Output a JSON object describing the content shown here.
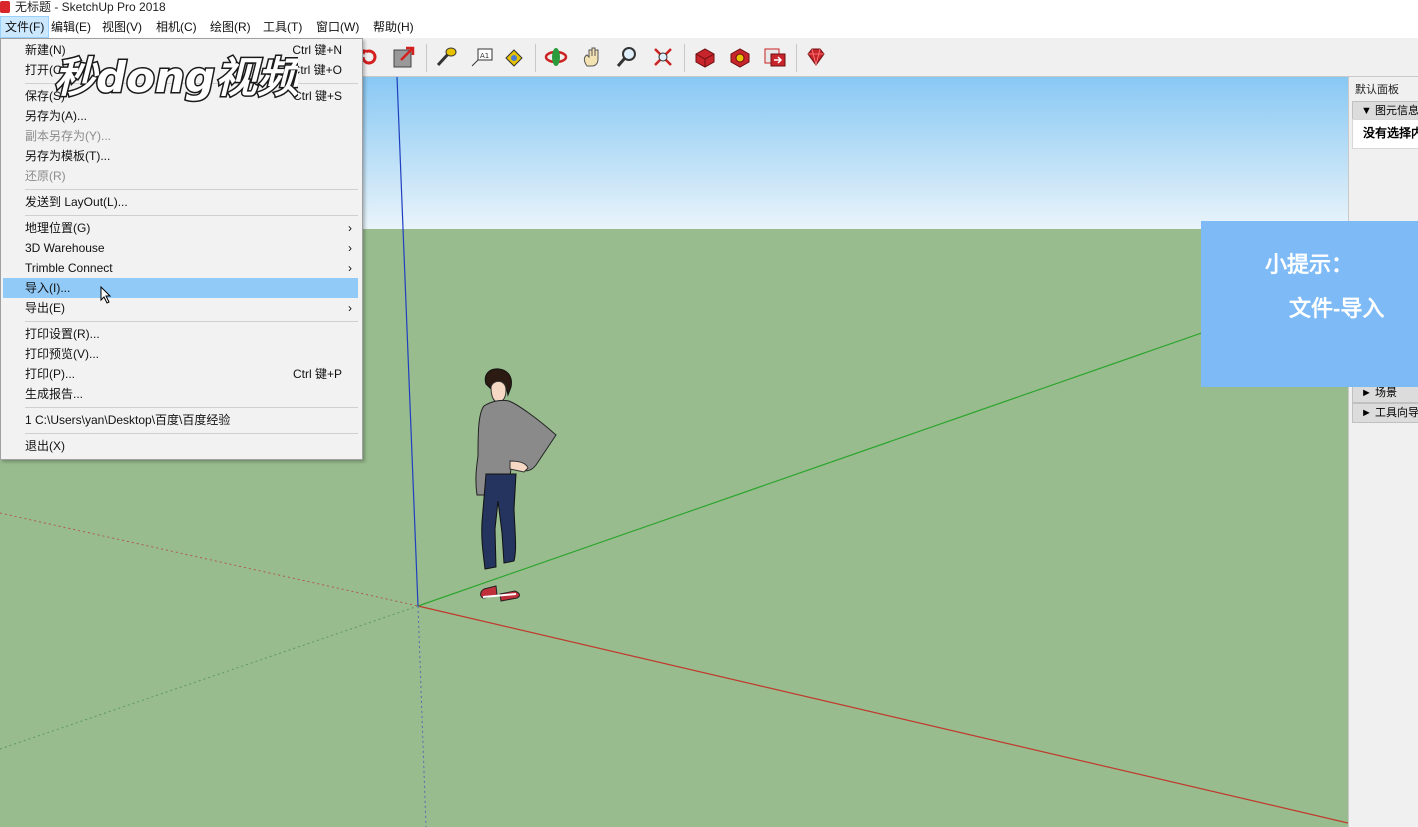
{
  "window": {
    "title": "无标题 - SketchUp Pro 2018"
  },
  "menubar": [
    {
      "label": "文件(F)",
      "active": true
    },
    {
      "label": "编辑(E)"
    },
    {
      "label": "视图(V)"
    },
    {
      "label": "相机(C)"
    },
    {
      "label": "绘图(R)"
    },
    {
      "label": "工具(T)"
    },
    {
      "label": "窗口(W)"
    },
    {
      "label": "帮助(H)"
    }
  ],
  "toolbar": {
    "icons": [
      "rotate-icon",
      "export-icon",
      "tape-measure-icon",
      "text-tool-icon",
      "paint-bucket-icon",
      "orbit-icon",
      "pan-icon",
      "zoom-icon",
      "zoom-extents-icon",
      "3d-warehouse-icon",
      "extension-warehouse-icon",
      "layout-icon",
      "ruby-icon"
    ]
  },
  "file_menu": {
    "items": [
      {
        "label": "新建(N)",
        "shortcut": "Ctrl 键+N"
      },
      {
        "label": "打开(O)...",
        "shortcut": "Ctrl 键+O"
      },
      {
        "label": "保存(S)",
        "shortcut": "Ctrl 键+S"
      },
      {
        "label": "另存为(A)..."
      },
      {
        "label": "副本另存为(Y)...",
        "disabled": true
      },
      {
        "label": "另存为模板(T)..."
      },
      {
        "label": "还原(R)",
        "disabled": true
      },
      {
        "label": "发送到 LayOut(L)..."
      },
      {
        "label": "地理位置(G)",
        "submenu": true
      },
      {
        "label": "3D Warehouse",
        "submenu": true
      },
      {
        "label": "Trimble Connect",
        "submenu": true
      },
      {
        "label": "导入(I)...",
        "highlighted": true
      },
      {
        "label": "导出(E)",
        "submenu": true
      },
      {
        "label": "打印设置(R)..."
      },
      {
        "label": "打印预览(V)..."
      },
      {
        "label": "打印(P)...",
        "shortcut": "Ctrl 键+P"
      },
      {
        "label": "生成报告..."
      },
      {
        "label": "1 C:\\Users\\yan\\Desktop\\百度\\百度经验"
      },
      {
        "label": "退出(X)"
      }
    ],
    "submenu_glyph": "›"
  },
  "watermark": {
    "text": "秒dong视频"
  },
  "tip": {
    "line1": "小提示：",
    "line2": "文件-导入"
  },
  "tray": {
    "title": "默认面板",
    "entity_info": "▼ 图元信息",
    "no_selection": "没有选择内容",
    "scenes": "► 场景",
    "instructor": "► 工具向导"
  },
  "colors": {
    "sky_top": "#88c8f4",
    "ground": "#98bc8e",
    "highlight": "#91c9f7",
    "tip_bg": "#7dbaf6",
    "axis_red": "#c0392b",
    "axis_green": "#2ea52e",
    "axis_blue": "#1f3fbf"
  }
}
